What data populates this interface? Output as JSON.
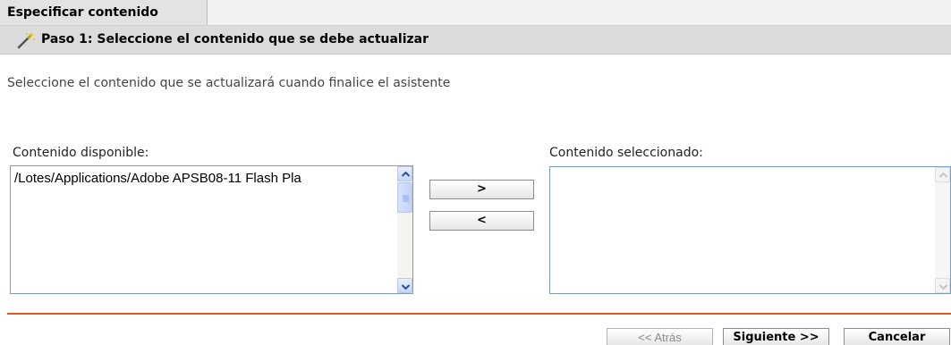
{
  "header": {
    "tab_label": "Especificar contenido",
    "step_title": "Paso 1: Seleccione el contenido que se debe actualizar"
  },
  "instruction": "Seleccione el contenido que se actualizará cuando finalice el asistente",
  "available": {
    "label": "Contenido disponible:",
    "items": [
      "/Lotes/Applications/Adobe APSB08-11 Flash Pla"
    ]
  },
  "selected": {
    "label": "Contenido seleccionado:",
    "items": []
  },
  "move_buttons": {
    "add_label": ">",
    "remove_label": "<"
  },
  "footer": {
    "back_label": "<< Atrás",
    "next_label": "Siguiente >>",
    "cancel_label": "Cancelar"
  },
  "colors": {
    "divider": "#e25b1f",
    "list_border": "#7f9db9"
  },
  "icons": {
    "step": "magic-wand-icon"
  }
}
